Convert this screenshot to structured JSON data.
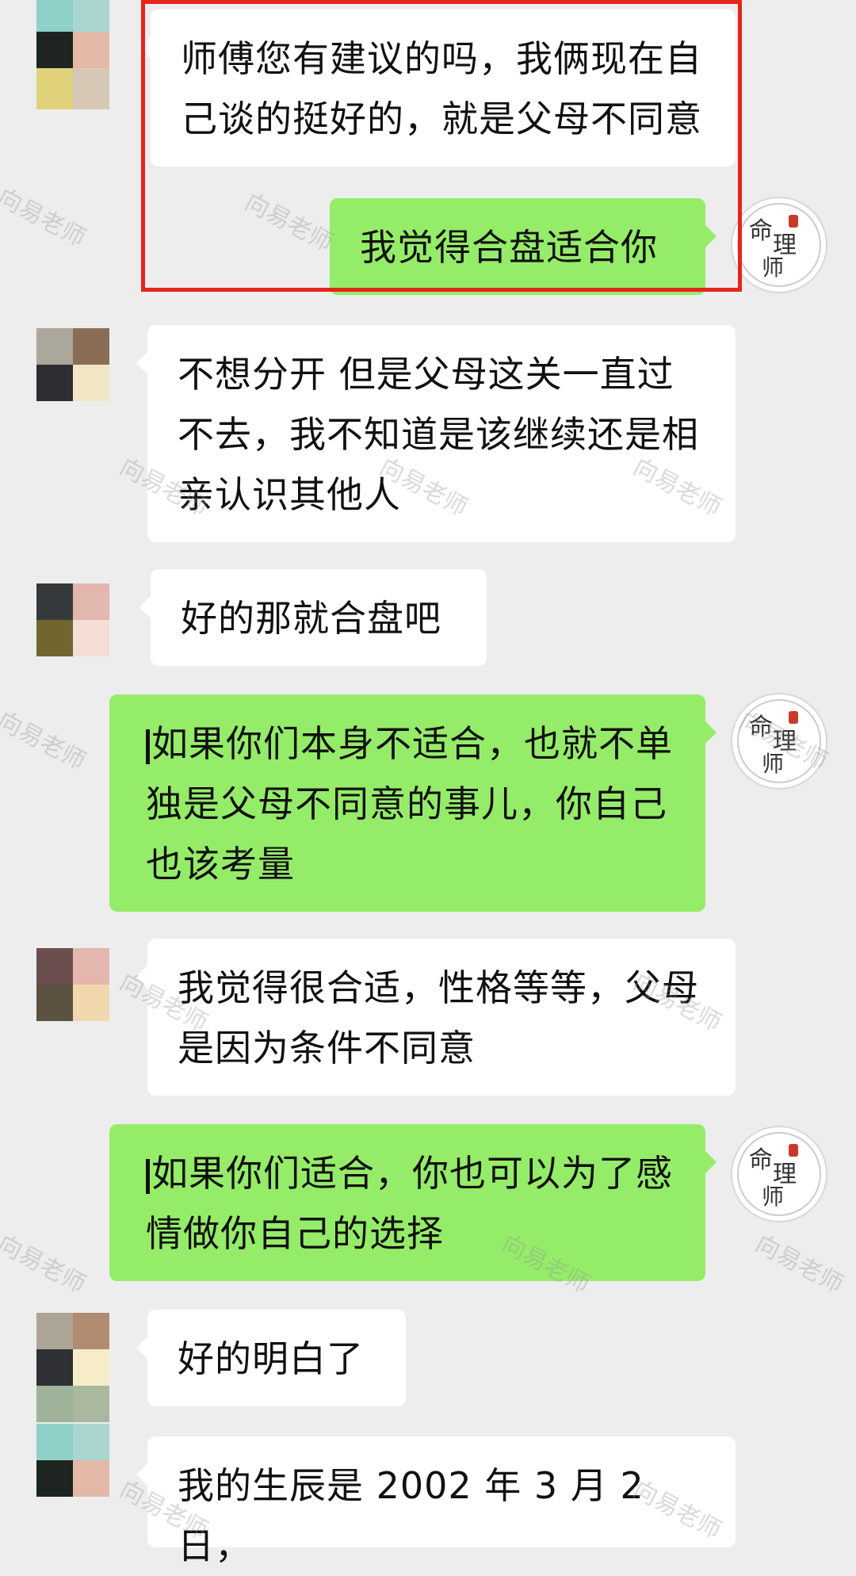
{
  "watermark_text": "向易老师",
  "advisor_seal_text": "命理师",
  "messages": [
    {
      "side": "in",
      "text": "师傅您有建议的吗，我俩现在自己谈的挺好的，就是父母不同意"
    },
    {
      "side": "out",
      "text": "我觉得合盘适合你"
    },
    {
      "side": "in",
      "text": "不想分开 但是父母这关一直过不去，我不知道是该继续还是相亲认识其他人"
    },
    {
      "side": "in",
      "text": "好的那就合盘吧"
    },
    {
      "side": "out",
      "text": "如果你们本身不适合，也就不单独是父母不同意的事儿，你自己也该考量"
    },
    {
      "side": "in",
      "text": "我觉得很合适，性格等等，父母是因为条件不同意"
    },
    {
      "side": "out",
      "text": "如果你们适合，你也可以为了感情做你自己的选择"
    },
    {
      "side": "in",
      "text": "好的明白了"
    },
    {
      "side": "in",
      "text": "我的生辰是 2002 年 3 月 2 日，"
    }
  ],
  "colors": {
    "background": "#ededed",
    "incoming_bubble": "#ffffff",
    "outgoing_bubble": "#95ec69",
    "highlight_border": "#e5241d"
  }
}
